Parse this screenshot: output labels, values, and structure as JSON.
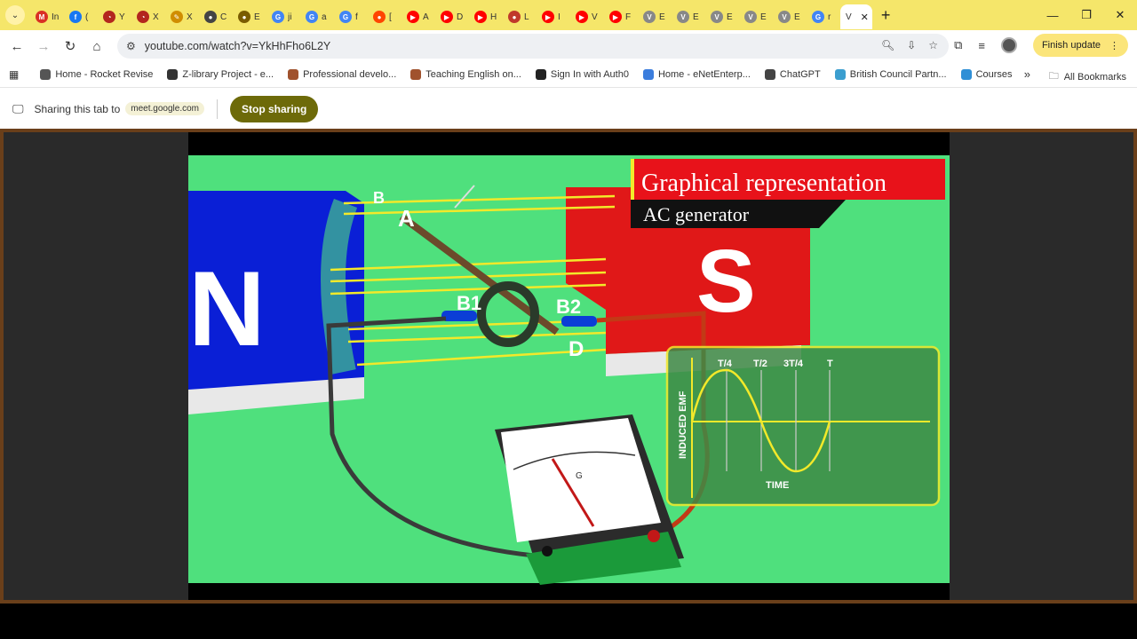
{
  "tabs": [
    {
      "fav": "M",
      "color": "#d93025",
      "title": "In"
    },
    {
      "fav": "f",
      "color": "#1877f2",
      "title": "("
    },
    {
      "fav": "◔",
      "color": "#b3261e",
      "title": "Y"
    },
    {
      "fav": "◔",
      "color": "#b3261e",
      "title": "X"
    },
    {
      "fav": "✎",
      "color": "#d08d00",
      "title": "X"
    },
    {
      "fav": "●",
      "color": "#444",
      "title": "C"
    },
    {
      "fav": "●",
      "color": "#7a5c00",
      "title": "E"
    },
    {
      "fav": "G",
      "color": "#4285f4",
      "title": "ji"
    },
    {
      "fav": "G",
      "color": "#4285f4",
      "title": "a"
    },
    {
      "fav": "G",
      "color": "#4285f4",
      "title": "f"
    },
    {
      "fav": "●",
      "color": "#ff4500",
      "title": "["
    },
    {
      "fav": "▶",
      "color": "#ff0000",
      "title": "A"
    },
    {
      "fav": "▶",
      "color": "#ff0000",
      "title": "D"
    },
    {
      "fav": "▶",
      "color": "#ff0000",
      "title": "H"
    },
    {
      "fav": "●",
      "color": "#c0392b",
      "title": "L"
    },
    {
      "fav": "▶",
      "color": "#ff0000",
      "title": "I"
    },
    {
      "fav": "▶",
      "color": "#ff0000",
      "title": "V"
    },
    {
      "fav": "▶",
      "color": "#ff0000",
      "title": "F"
    },
    {
      "fav": "V",
      "color": "#888",
      "title": "E"
    },
    {
      "fav": "V",
      "color": "#888",
      "title": "E"
    },
    {
      "fav": "V",
      "color": "#888",
      "title": "E"
    },
    {
      "fav": "V",
      "color": "#888",
      "title": "E"
    },
    {
      "fav": "V",
      "color": "#888",
      "title": "E"
    },
    {
      "fav": "G",
      "color": "#4285f4",
      "title": "r"
    }
  ],
  "active_tab": {
    "title": "V"
  },
  "toolbar": {
    "url": "youtube.com/watch?v=YkHhFho6L2Y",
    "finish_update": "Finish update"
  },
  "bookmarks": [
    {
      "label": "Home - Rocket Revise",
      "color": "#555"
    },
    {
      "label": "Z-library Project - e...",
      "color": "#333"
    },
    {
      "label": "Professional develo...",
      "color": "#a0522d"
    },
    {
      "label": "Teaching English on...",
      "color": "#a0522d"
    },
    {
      "label": "Sign In with Auth0",
      "color": "#222"
    },
    {
      "label": "Home - eNetEnterp...",
      "color": "#3b7ddd"
    },
    {
      "label": "ChatGPT",
      "color": "#444"
    },
    {
      "label": "British Council Partn...",
      "color": "#3b9ecf"
    },
    {
      "label": "Courses",
      "color": "#2f8fd6"
    }
  ],
  "bookmarks_all": "All Bookmarks",
  "sharing": {
    "text": "Sharing this tab to",
    "target": "meet.google.com",
    "stop_label": "Stop sharing"
  },
  "video": {
    "title": "Graphical representation",
    "subtitle": "AC generator",
    "magnet_left": "N",
    "magnet_right": "S",
    "labels": {
      "a": "A",
      "b": "B",
      "b1": "B1",
      "b2": "B2",
      "d": "D",
      "g": "G"
    },
    "graph": {
      "ylabel": "INDUCED EMF",
      "xlabel": "TIME",
      "ticks": [
        "T/4",
        "T/2",
        "3T/4",
        "T"
      ]
    }
  }
}
